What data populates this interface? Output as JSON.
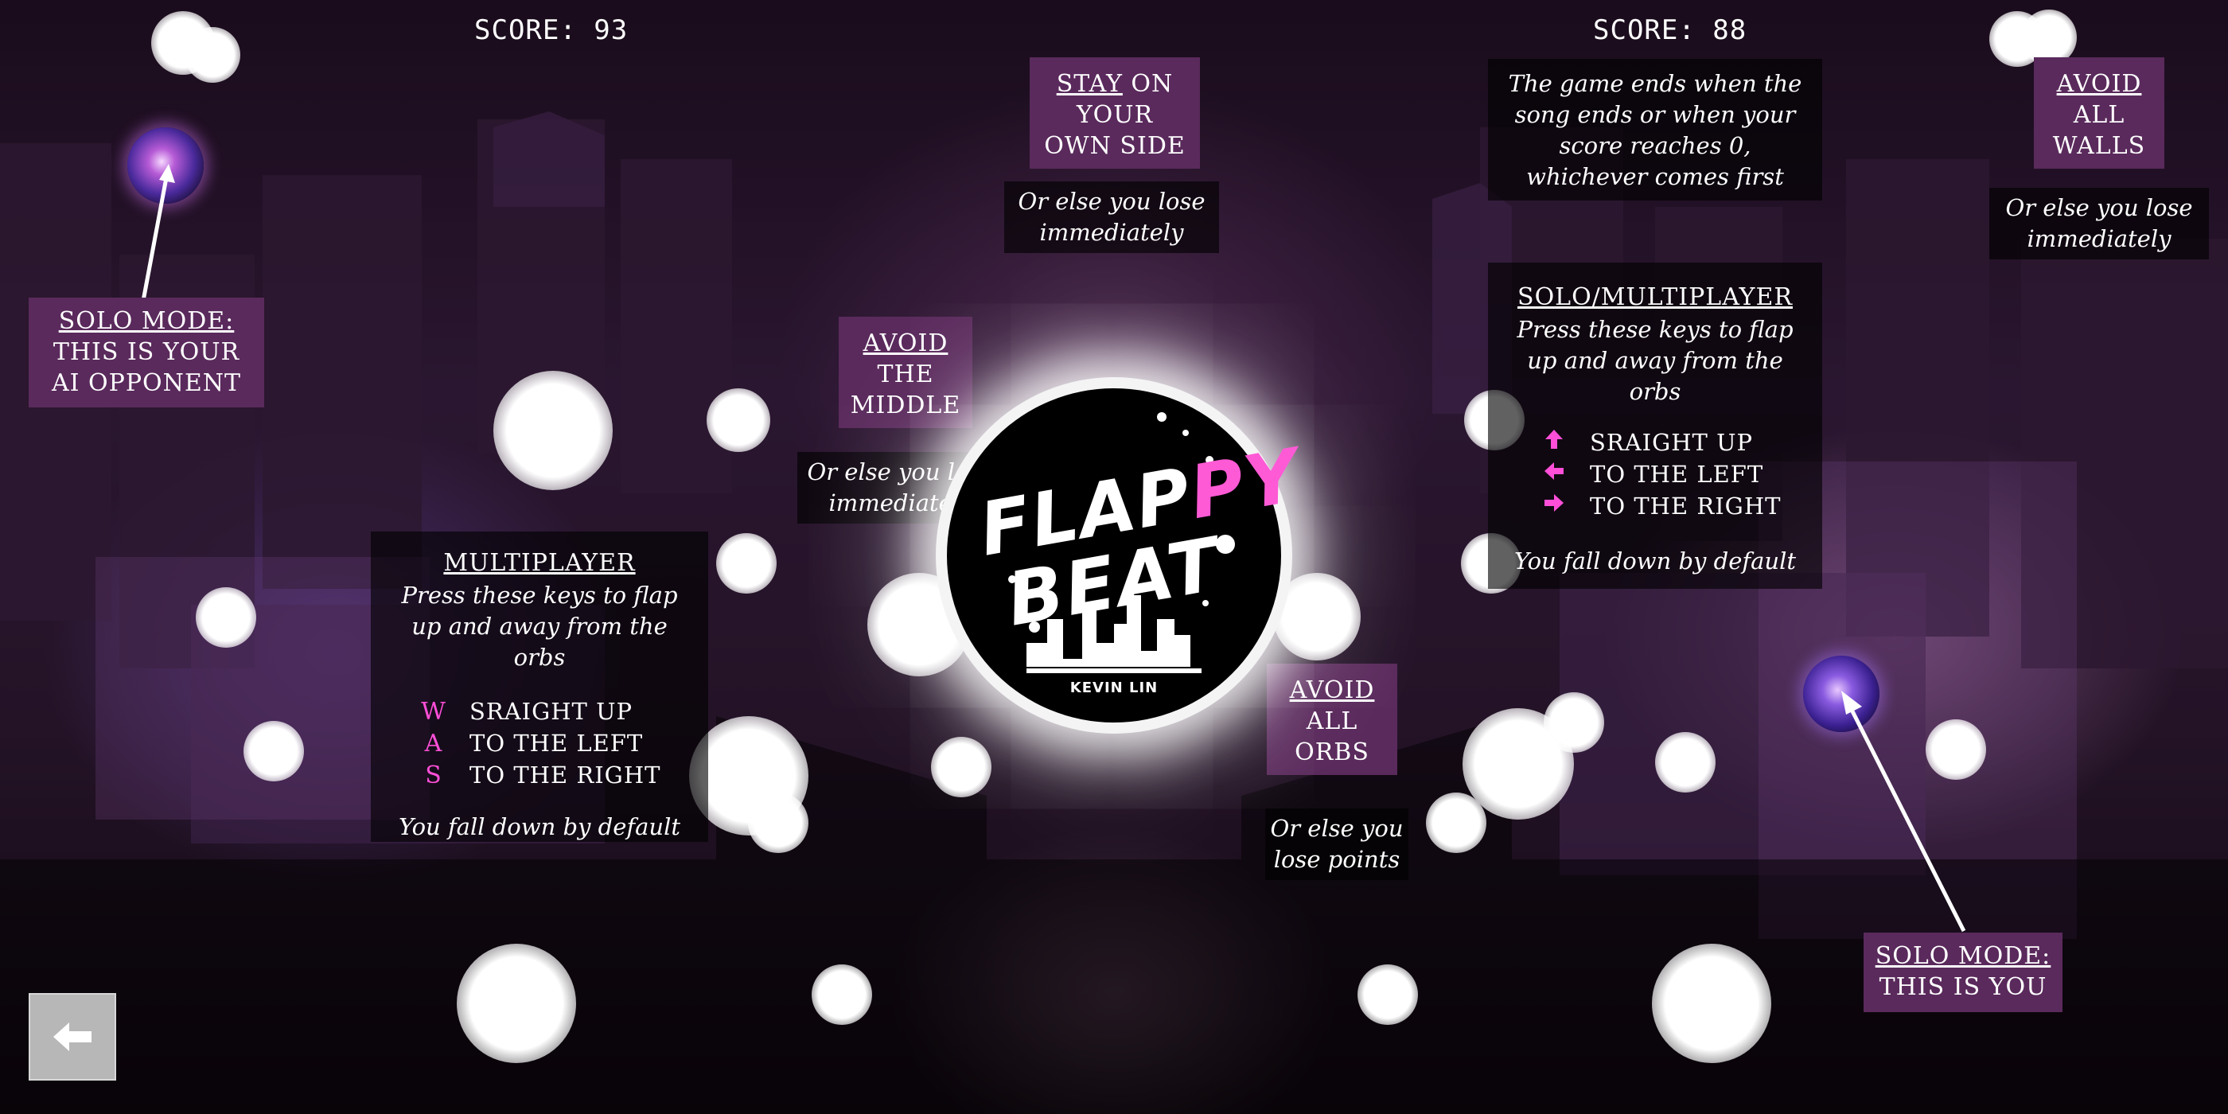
{
  "scores": {
    "left": "SCORE: 93",
    "right": "SCORE: 88"
  },
  "ai_callout": {
    "title": "SOLO MODE:",
    "line1": "THIS IS YOUR",
    "line2": "AI OPPONENT"
  },
  "you_callout": {
    "title": "SOLO MODE:",
    "line1": "THIS IS YOU"
  },
  "stay_side": {
    "lead": "STAY",
    "rest1": " ON",
    "line2": "YOUR",
    "line3": "OWN SIDE",
    "note": "Or else you lose immediately"
  },
  "avoid_middle": {
    "title": "AVOID",
    "line2": "THE",
    "line3": "MIDDLE",
    "note": "Or else you lose immediately"
  },
  "avoid_walls": {
    "title": "AVOID",
    "line2": "ALL",
    "line3": "WALLS",
    "note": "Or else you lose immediately"
  },
  "avoid_orbs": {
    "title": "AVOID",
    "line2": "ALL",
    "line3": "ORBS",
    "note": "Or else you lose points"
  },
  "game_end": {
    "text": "The game ends when the song ends or when your score reaches 0, whichever comes first"
  },
  "multiplayer": {
    "title": "MULTIPLAYER",
    "desc": "Press these keys to flap up and away from the orbs",
    "keys": [
      {
        "key": "W",
        "label": "SRAIGHT UP"
      },
      {
        "key": "A",
        "label": "TO THE LEFT"
      },
      {
        "key": "S",
        "label": "TO THE RIGHT"
      }
    ],
    "footer": "You fall down by default"
  },
  "solo_multi": {
    "title": "SOLO/MULTIPLAYER",
    "desc": "Press these keys to flap up and away from the orbs",
    "keys": [
      {
        "icon": "arrow-up-icon",
        "label": "SRAIGHT UP"
      },
      {
        "icon": "arrow-left-icon",
        "label": "TO THE LEFT"
      },
      {
        "icon": "arrow-right-icon",
        "label": "TO THE RIGHT"
      }
    ],
    "footer": "You fall down by default"
  },
  "logo": {
    "word1_a": "FLAP",
    "word1_b": "PY",
    "word2": "BEAT",
    "author": "KEVIN LIN"
  },
  "colors": {
    "panel_purple": "#5a2a5c",
    "key_pink": "#ff4fd8",
    "logo_pink": "#ff5ad6"
  },
  "back_button": {
    "icon": "arrow-left-icon"
  }
}
